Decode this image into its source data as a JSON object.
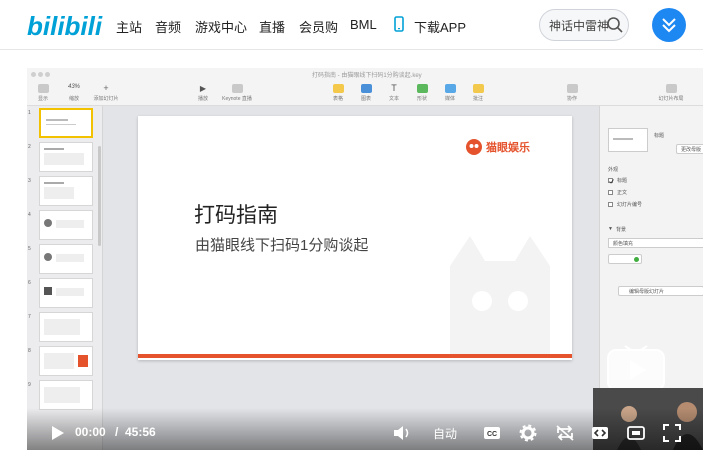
{
  "site": {
    "logo_text": "bilibili",
    "nav": [
      {
        "label": "主站"
      },
      {
        "label": "音频"
      },
      {
        "label": "游戏中心"
      },
      {
        "label": "直播"
      },
      {
        "label": "会员购"
      },
      {
        "label": "BML"
      },
      {
        "label": "下载APP"
      }
    ],
    "search_value": "神话中雷神",
    "brand_color": "#00a1d6",
    "accent_color": "#1e88f2"
  },
  "keynote": {
    "title": "打码指南 - 由猫眼线下扫码1分购谈起.key",
    "toolbar": [
      {
        "label": "显示"
      },
      {
        "label": "缩放"
      },
      {
        "label": "添加幻灯片"
      },
      {
        "label": "播放"
      },
      {
        "label": "Keynote 直播"
      },
      {
        "label": "表格"
      },
      {
        "label": "图表"
      },
      {
        "label": "文本"
      },
      {
        "label": "形状"
      },
      {
        "label": "媒体"
      },
      {
        "label": "批注"
      },
      {
        "label": "协作"
      },
      {
        "label": "幻灯片布局"
      }
    ],
    "zoom": "43%",
    "slides": [
      "1",
      "2",
      "3",
      "4",
      "5",
      "6",
      "7",
      "8",
      "9"
    ],
    "slide": {
      "title": "打码指南",
      "subtitle": "由猫眼线下扫码1分购谈起",
      "logo_text": "猫眼娱乐",
      "brand_color": "#e5532d"
    },
    "inspector": {
      "layout_name": "标题",
      "change_master": "更改母版",
      "appearance": "外观",
      "options": [
        {
          "label": "标题",
          "checked": true
        },
        {
          "label": "正文",
          "checked": false
        },
        {
          "label": "幻灯片编号",
          "checked": false
        }
      ],
      "background": "背景",
      "fill": "颜色填充",
      "edit_master": "编辑母版幻灯片"
    }
  },
  "player": {
    "current_time": "00:00",
    "separator": "/",
    "duration": "45:56",
    "auto_label": "自动",
    "progress": 0
  }
}
